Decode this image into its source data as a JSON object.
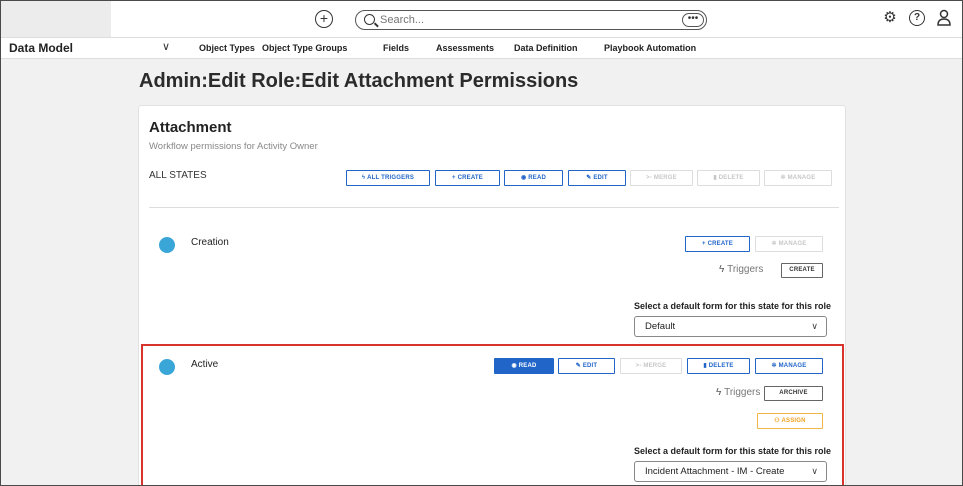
{
  "topbar": {
    "add_icon": "plus-circle-icon",
    "search_placeholder": "Search...",
    "more_label": "•••",
    "icons": [
      "gear-icon",
      "help-icon",
      "user-icon"
    ],
    "help_glyph": "?"
  },
  "nav": {
    "title": "Data Model",
    "chevron": "∨",
    "items": [
      "Object Types",
      "Object Type Groups",
      "Fields",
      "Assessments",
      "Data Definition",
      "Playbook Automation"
    ]
  },
  "page": {
    "title": "Admin:Edit Role:Edit Attachment Permissions"
  },
  "card": {
    "title": "Attachment",
    "subtitle": "Workflow permissions for Activity Owner",
    "all_states_label": "ALL STATES",
    "all_state_buttons": {
      "all_triggers": "ALL TRIGGERS",
      "create": "+ CREATE",
      "read": "READ",
      "edit": "EDIT",
      "merge": ">- MERGE",
      "delete": "DELETE",
      "manage": "MANAGE"
    }
  },
  "states": [
    {
      "name": "Creation",
      "dot_color": "#3aa6d8",
      "buttons": {
        "create": "+ CREATE",
        "manage": "MANAGE"
      },
      "triggers_label": "Triggers",
      "triggers": [
        "CREATE"
      ],
      "form_label": "Select a default form for this state for this role",
      "form_value": "Default"
    },
    {
      "name": "Active",
      "dot_color": "#3aa6d8",
      "buttons": {
        "read": "READ",
        "edit": "EDIT",
        "merge": ">- MERGE",
        "delete": "DELETE",
        "manage": "MANAGE"
      },
      "triggers_label": "Triggers",
      "triggers": [
        "ARCHIVE"
      ],
      "assign": "ASSIGN",
      "form_label": "Select a default form for this state for this role",
      "form_value": "Incident Attachment - IM - Create"
    }
  ],
  "colors": {
    "accent": "#2165c8",
    "highlight": "#d9342b",
    "assign": "#f0a020",
    "state_dot": "#3aa6d8"
  }
}
